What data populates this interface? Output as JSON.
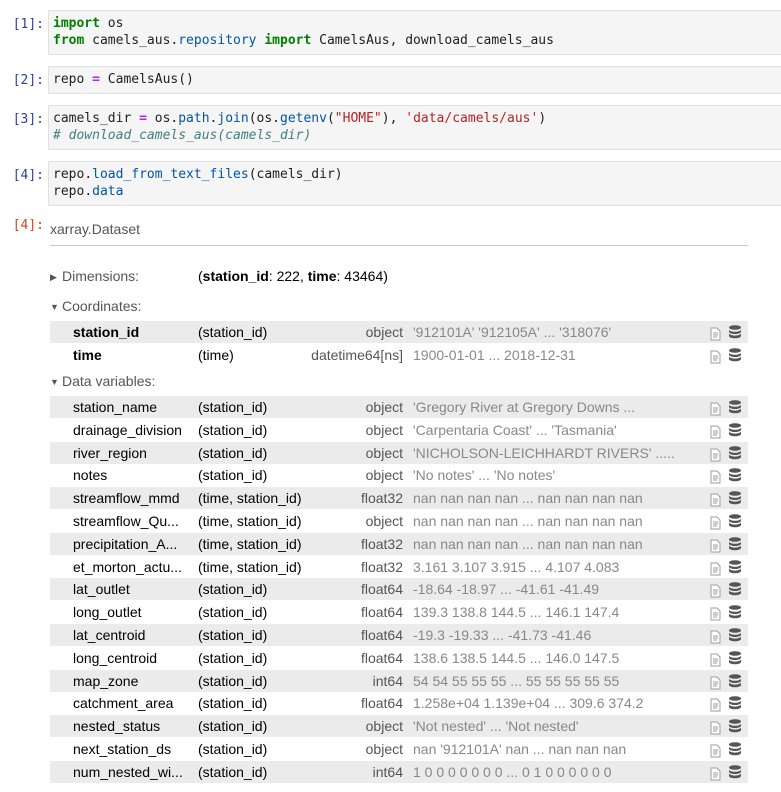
{
  "cells": [
    {
      "prompt": "[1]:"
    },
    {
      "prompt": "[2]:"
    },
    {
      "prompt": "[3]:"
    },
    {
      "prompt": "[4]:"
    },
    {
      "prompt": "[4]:"
    }
  ],
  "code": {
    "c1_l1": [
      "import",
      " os"
    ],
    "c1_l2": [
      "from",
      " camels_aus",
      ".",
      "repository",
      " ",
      "import",
      " CamelsAus, download_camels_aus"
    ],
    "c2": [
      "repo ",
      "=",
      " CamelsAus()"
    ],
    "c3_l1": [
      "camels_dir ",
      "=",
      " os",
      ".",
      "path",
      ".",
      "join",
      "(os",
      ".",
      "getenv",
      "(",
      "\"HOME\"",
      "), ",
      "'data/camels/aus'",
      ")"
    ],
    "c3_l2": "# download_camels_aus(camels_dir)",
    "c4_l1": [
      "repo",
      ".",
      "load_from_text_files",
      "(camels_dir)"
    ],
    "c4_l2": [
      "repo",
      ".",
      "data"
    ]
  },
  "xarray": {
    "title": "xarray.Dataset",
    "dimensions_label": "Dimensions:",
    "dims": {
      "open": "(",
      "d1_name": "station_id",
      "d1_sep": ": ",
      "d1_val": "222",
      "comma": ", ",
      "d2_name": "time",
      "d2_sep": ": ",
      "d2_val": "43464",
      "close": ")"
    },
    "coordinates_label": "Coordinates:",
    "data_variables_label": "Data variables:",
    "coordinates": [
      {
        "name": "station_id",
        "dims": "(station_id)",
        "dtype": "object",
        "preview": "'912101A' '912105A' ... '318076'"
      },
      {
        "name": "time",
        "dims": "(time)",
        "dtype": "datetime64[ns]",
        "preview": "1900-01-01 ... 2018-12-31"
      }
    ],
    "variables": [
      {
        "name": "station_name",
        "dims": "(station_id)",
        "dtype": "object",
        "preview": "'Gregory River at Gregory Downs ..."
      },
      {
        "name": "drainage_division",
        "dims": "(station_id)",
        "dtype": "object",
        "preview": "'Carpentaria Coast' ... 'Tasmania'"
      },
      {
        "name": "river_region",
        "dims": "(station_id)",
        "dtype": "object",
        "preview": "'NICHOLSON-LEICHHARDT RIVERS' ....."
      },
      {
        "name": "notes",
        "dims": "(station_id)",
        "dtype": "object",
        "preview": "'No notes' ... 'No notes'"
      },
      {
        "name": "streamflow_mmd",
        "dims": "(time, station_id)",
        "dtype": "float32",
        "preview": "nan nan nan nan ... nan nan nan nan"
      },
      {
        "name": "streamflow_Qu...",
        "dims": "(time, station_id)",
        "dtype": "object",
        "preview": "nan nan nan nan ... nan nan nan nan"
      },
      {
        "name": "precipitation_A...",
        "dims": "(time, station_id)",
        "dtype": "float32",
        "preview": "nan nan nan nan ... nan nan nan nan"
      },
      {
        "name": "et_morton_actu...",
        "dims": "(time, station_id)",
        "dtype": "float32",
        "preview": "3.161 3.107 3.915 ... 4.107 4.083"
      },
      {
        "name": "lat_outlet",
        "dims": "(station_id)",
        "dtype": "float64",
        "preview": "-18.64 -18.97 ... -41.61 -41.49"
      },
      {
        "name": "long_outlet",
        "dims": "(station_id)",
        "dtype": "float64",
        "preview": "139.3 138.8 144.5 ... 146.1 147.4"
      },
      {
        "name": "lat_centroid",
        "dims": "(station_id)",
        "dtype": "float64",
        "preview": "-19.3 -19.33 ... -41.73 -41.46"
      },
      {
        "name": "long_centroid",
        "dims": "(station_id)",
        "dtype": "float64",
        "preview": "138.6 138.5 144.5 ... 146.0 147.5"
      },
      {
        "name": "map_zone",
        "dims": "(station_id)",
        "dtype": "int64",
        "preview": "54 54 55 55 55 ... 55 55 55 55 55"
      },
      {
        "name": "catchment_area",
        "dims": "(station_id)",
        "dtype": "float64",
        "preview": "1.258e+04 1.139e+04 ... 309.6 374.2"
      },
      {
        "name": "nested_status",
        "dims": "(station_id)",
        "dtype": "object",
        "preview": "'Not nested' ... 'Not nested'"
      },
      {
        "name": "next_station_ds",
        "dims": "(station_id)",
        "dtype": "object",
        "preview": "nan '912101A' nan ... nan nan nan"
      },
      {
        "name": "num_nested_wi...",
        "dims": "(station_id)",
        "dtype": "int64",
        "preview": "1 0 0 0 0 0 0 0 ... 0 1 0 0 0 0 0 0"
      }
    ],
    "icons": {
      "attrs": "file-text-icon",
      "data": "database-icon"
    }
  }
}
